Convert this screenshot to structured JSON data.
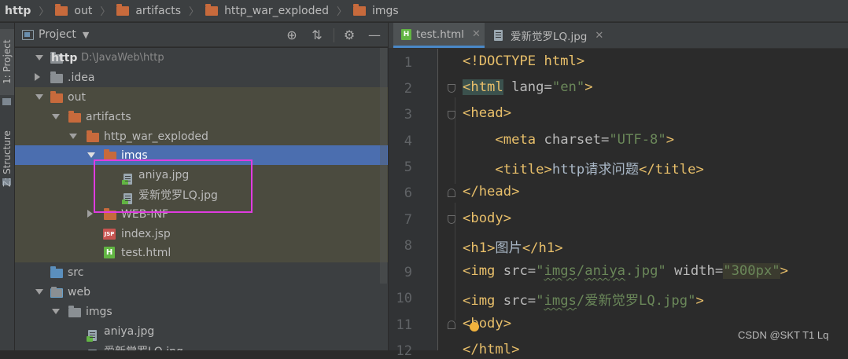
{
  "breadcrumb": [
    "http",
    "out",
    "artifacts",
    "http_war_exploded",
    "imgs"
  ],
  "left_strip": {
    "project_tab": "1: Project",
    "structure_tab": "Z: Structure"
  },
  "project_panel": {
    "title": "Project",
    "dropdown_icon": "chevron-down-icon",
    "actions": [
      "crosshair-icon",
      "collapse-all-icon",
      "gear-icon",
      "minimize-icon"
    ]
  },
  "tree": [
    {
      "label": "http",
      "extra": "D:\\JavaWeb\\http",
      "kind": "module",
      "expanded": true
    },
    {
      "label": ".idea",
      "kind": "folder-grey",
      "expanded": false
    },
    {
      "label": "out",
      "kind": "folder-orange",
      "expanded": true
    },
    {
      "label": "artifacts",
      "kind": "folder-orange",
      "expanded": true
    },
    {
      "label": "http_war_exploded",
      "kind": "folder-orange",
      "expanded": true
    },
    {
      "label": "imgs",
      "kind": "folder-orange",
      "expanded": true,
      "selected": true
    },
    {
      "label": "aniya.jpg",
      "kind": "image-file"
    },
    {
      "label": "爱新觉罗LQ.jpg",
      "kind": "image-file"
    },
    {
      "label": "WEB-INF",
      "kind": "folder-orange",
      "expanded": false
    },
    {
      "label": "index.jsp",
      "kind": "jsp-file"
    },
    {
      "label": "test.html",
      "kind": "html-file"
    },
    {
      "label": "src",
      "kind": "folder-blue"
    },
    {
      "label": "web",
      "kind": "folder-web",
      "expanded": true
    },
    {
      "label": "imgs",
      "kind": "folder-grey",
      "expanded": true
    },
    {
      "label": "aniya.jpg",
      "kind": "image-file"
    },
    {
      "label": "爱新觉罗LQ.jpg",
      "kind": "image-file"
    }
  ],
  "tabs": [
    {
      "label": "test.html",
      "icon": "html-file-icon",
      "active": true
    },
    {
      "label": "爱新觉罗LQ.jpg",
      "icon": "image-file-icon",
      "active": false
    }
  ],
  "line_numbers": [
    "1",
    "2",
    "3",
    "4",
    "5",
    "6",
    "7",
    "8",
    "9",
    "10",
    "11",
    "12"
  ],
  "code": {
    "l1": "<!DOCTYPE html>",
    "l2_open": "<",
    "l2_tag": "html",
    "l2_attr": " lang=",
    "l2_val": "\"en\"",
    "l2_close": ">",
    "l3_open": "<",
    "l3_tag": "head",
    "l3_close": ">",
    "l4_indent": "    ",
    "l4_open": "<",
    "l4_tag": "meta",
    "l4_attr": " charset=",
    "l4_val": "\"UTF-8\"",
    "l4_close": ">",
    "l5_indent": "    ",
    "l5_open": "<",
    "l5_tag": "title",
    "l5_close": ">",
    "l5_text": "http请求问题",
    "l5_end_open": "</",
    "l5_end_tag": "title",
    "l5_end_close": ">",
    "l6_open": "</",
    "l6_tag": "head",
    "l6_close": ">",
    "l7_open": "<",
    "l7_tag": "body",
    "l7_close": ">",
    "l8_open": "<",
    "l8_tag": "h1",
    "l8_close": ">",
    "l8_text": "图片",
    "l8_end_open": "</",
    "l8_end_tag": "h1",
    "l8_end_close": ">",
    "l9_open": "<",
    "l9_tag": "img",
    "l9_attr1": " src=",
    "l9_val1_q": "\"",
    "l9_val1_a": "imgs",
    "l9_val1_b": "/",
    "l9_val1_c": "aniya",
    "l9_val1_d": ".jpg\"",
    "l9_attr2": " width=",
    "l9_val2": "\"300px\"",
    "l9_close": ">",
    "l10_open": "<",
    "l10_tag": "img",
    "l10_attr": " src=",
    "l10_val_q": "\"",
    "l10_val_a": "imgs",
    "l10_val_b": "/爱新觉罗LQ.jpg\"",
    "l10_close": ">",
    "l11_open": "<",
    "l11_tag": "body",
    "l11_close": ">",
    "l12": "</html>"
  },
  "watermark": "CSDN @SKT T1 Lq"
}
